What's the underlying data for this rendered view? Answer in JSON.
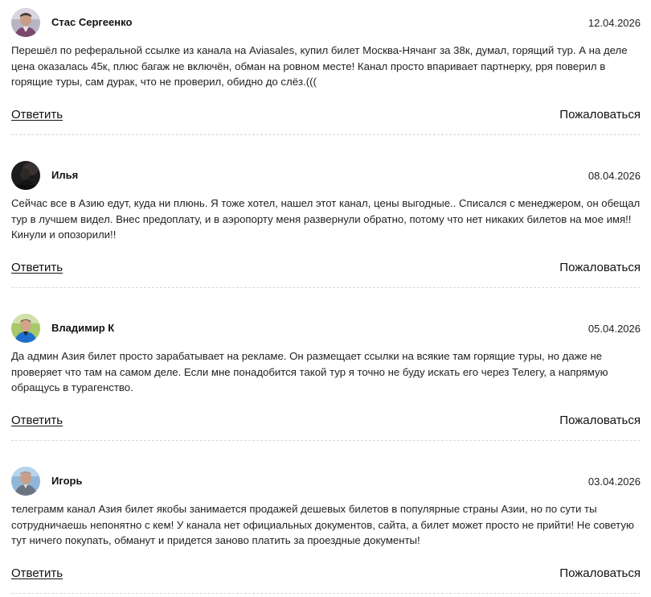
{
  "comments": [
    {
      "author": "Стас Сергеенко",
      "date": "12.04.2026",
      "text": "Перешёл по реферальной ссылке из канала на Aviasales, купил билет Москва-Нячанг за 38к, думал, горящий тур. А на деле цена оказалась 45к, плюс багаж не включён, обман на ровном месте! Канал просто впаривает партнерку, рря поверил в горящие туры, сам дурак, что не проверил, обидно до слёз.(((",
      "reply_label": "Ответить",
      "report_label": "Пожаловаться",
      "avatar_icon": "user-photo-avatar"
    },
    {
      "author": "Илья",
      "date": "08.04.2026",
      "text": "Сейчас все в Азию едут, куда ни плюнь. Я тоже хотел, нашел этот канал, цены выгодные.. Списался с менеджером, он обещал тур в лучшем видел. Внес предоплату, и в аэропорту меня развернули обратно, потому что нет никаких билетов на мое имя!! Кинули и опозорили!!",
      "reply_label": "Ответить",
      "report_label": "Пожаловаться",
      "avatar_icon": "user-photo-avatar"
    },
    {
      "author": "Владимир К",
      "date": "05.04.2026",
      "text": "Да админ Азия билет просто зарабатывает на рекламе. Он размещает ссылки на всякие там горящие туры, но даже не проверяет что там на самом деле. Если мне понадобится такой тур я точно не буду искать его через Телегу, а напрямую обращусь в турагенство.",
      "reply_label": "Ответить",
      "report_label": "Пожаловаться",
      "avatar_icon": "user-photo-avatar"
    },
    {
      "author": "Игорь",
      "date": "03.04.2026",
      "text": "телеграмм канал Азия билет якобы занимается продажей дешевых билетов в популярные страны Азии, но по сути ты сотрудничаешь непонятно с кем! У канала нет официальных документов, сайта, а билет может просто не прийти! Не советую тут ничего покупать, обманут и придется заново платить за проездные документы!",
      "reply_label": "Ответить",
      "report_label": "Пожаловаться",
      "avatar_icon": "user-photo-avatar"
    }
  ],
  "colors": {
    "text": "#222222",
    "divider": "#d8d8d8"
  }
}
